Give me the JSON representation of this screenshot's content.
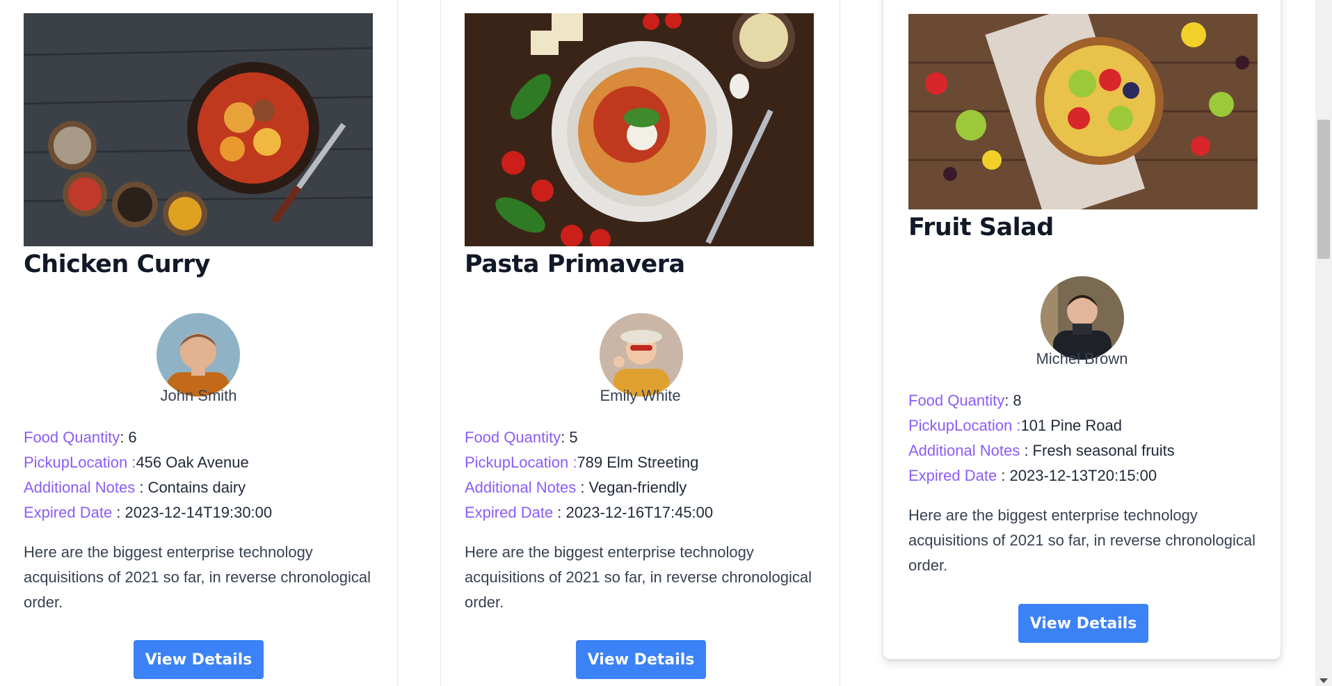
{
  "cards": [
    {
      "title": "Chicken Curry",
      "donor": "John Smith",
      "quantity_label": "Food Quantity",
      "quantity_value": ": 6",
      "location_label": "PickupLocation :",
      "location_value": "456 Oak Avenue",
      "notes_label": "Additional Notes",
      "notes_value": " : Contains dairy",
      "expired_label": "Expired Date",
      "expired_value": " : 2023-12-14T19:30:00",
      "description": "Here are the biggest enterprise technology acquisitions of 2021 so far, in reverse chronological order.",
      "button_label": "View Details"
    },
    {
      "title": "Pasta Primavera",
      "donor": "Emily White",
      "quantity_label": "Food Quantity",
      "quantity_value": ": 5",
      "location_label": "PickupLocation :",
      "location_value": "789 Elm Streeting",
      "notes_label": "Additional Notes",
      "notes_value": " : Vegan-friendly",
      "expired_label": "Expired Date",
      "expired_value": " : 2023-12-16T17:45:00",
      "description": "Here are the biggest enterprise technology acquisitions of 2021 so far, in reverse chronological order.",
      "button_label": "View Details"
    },
    {
      "title": "Fruit Salad",
      "donor": "Michel Brown",
      "quantity_label": "Food Quantity",
      "quantity_value": ": 8",
      "location_label": "PickupLocation :",
      "location_value": "101 Pine Road",
      "notes_label": "Additional Notes",
      "notes_value": " : Fresh seasonal fruits",
      "expired_label": "Expired Date",
      "expired_value": " : 2023-12-13T20:15:00",
      "description": "Here are the biggest enterprise technology acquisitions of 2021 so far, in reverse chronological order.",
      "button_label": "View Details"
    }
  ],
  "colors": {
    "label": "#8b5cf6",
    "button": "#3b82f6",
    "title": "#111827"
  },
  "icons": [
    "food-photo",
    "donor-avatar",
    "scroll-down-arrow"
  ]
}
